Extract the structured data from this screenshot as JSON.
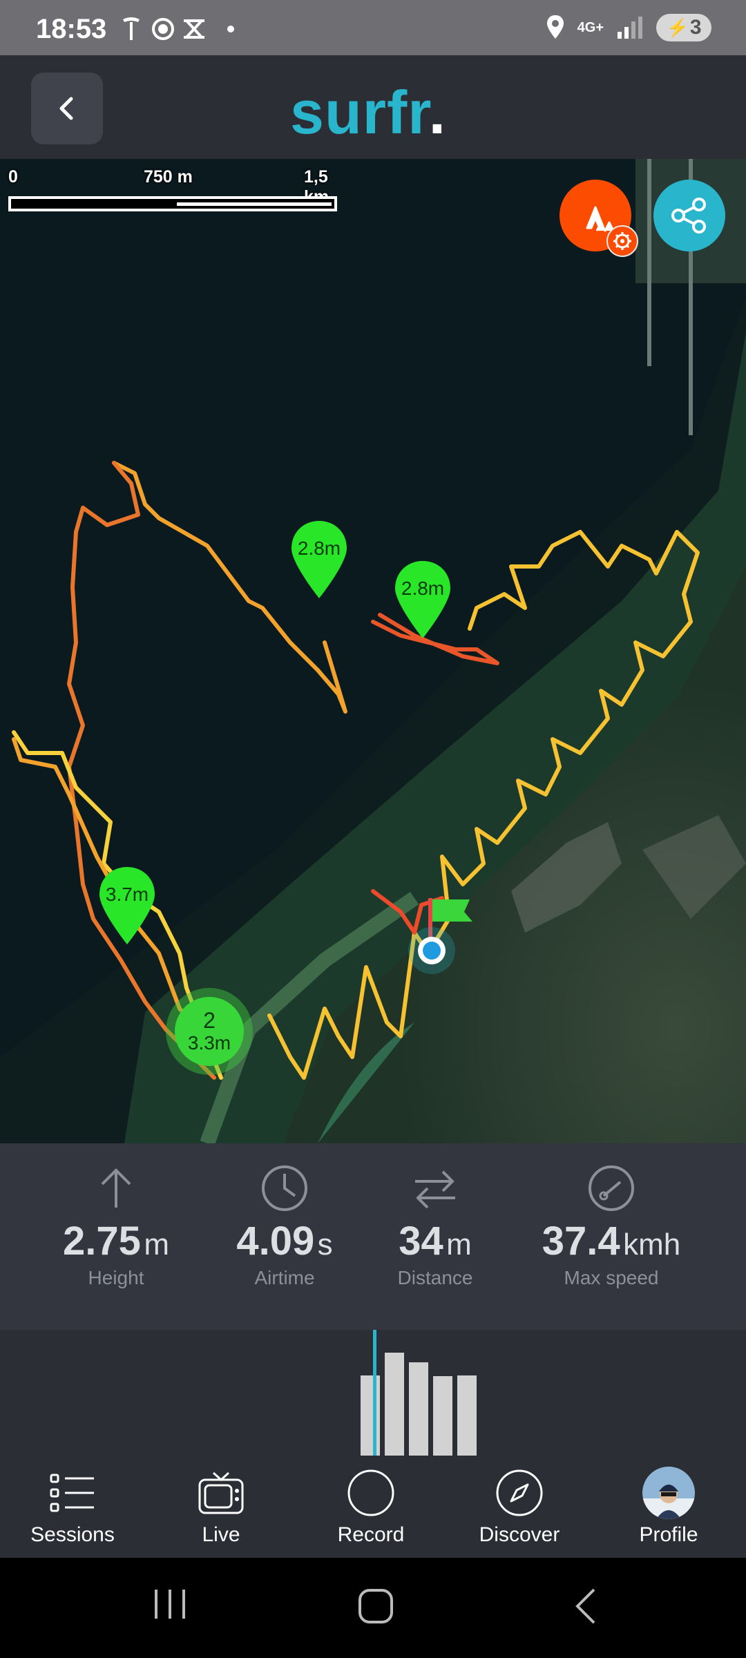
{
  "status_bar": {
    "time": "18:53",
    "left_icons": [
      "tesla-icon",
      "chrome-icon",
      "swipe-icon",
      "notification-dot"
    ],
    "network": "4G+",
    "battery": "3",
    "right_icons": [
      "location-icon",
      "4g-icon",
      "signal-icon",
      "battery-icon"
    ]
  },
  "header": {
    "logo_text": "surfr",
    "logo_dot": ".",
    "accent": "#29b6cc"
  },
  "map": {
    "scale": {
      "start": "0",
      "mid": "750 m",
      "end": "1,5 km"
    },
    "markers": [
      {
        "label": "2.8m"
      },
      {
        "label": "2.8m"
      },
      {
        "label": "3.7m"
      }
    ],
    "cluster": {
      "count": "2",
      "label": "3.3m"
    },
    "strava_color": "#fc4c02",
    "share_color": "#29b6cc"
  },
  "stats": [
    {
      "icon": "arrow-up-icon",
      "value": "2.75",
      "unit": "m",
      "label": "Height"
    },
    {
      "icon": "clock-icon",
      "value": "4.09",
      "unit": "s",
      "label": "Airtime"
    },
    {
      "icon": "transfer-arrows-icon",
      "value": "34",
      "unit": "m",
      "label": "Distance"
    },
    {
      "icon": "speedometer-icon",
      "value": "37.4",
      "unit": "kmh",
      "label": "Max speed"
    }
  ],
  "histogram": {
    "bar_levels": [
      0.64,
      0.82,
      0.74,
      0.63,
      0.64
    ],
    "selected_index": 0
  },
  "nav": [
    {
      "icon": "list-icon",
      "label": "Sessions"
    },
    {
      "icon": "tv-icon",
      "label": "Live"
    },
    {
      "icon": "record-icon",
      "label": "Record"
    },
    {
      "icon": "compass-icon",
      "label": "Discover"
    },
    {
      "icon": "avatar",
      "label": "Profile"
    }
  ]
}
